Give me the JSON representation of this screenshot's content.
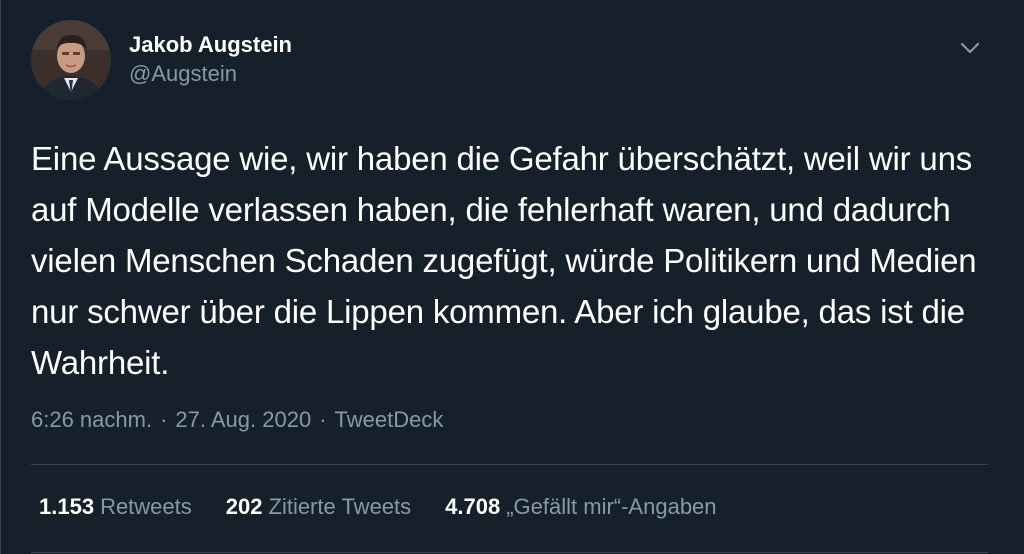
{
  "author": {
    "display_name": "Jakob Augstein",
    "handle": "@Augstein"
  },
  "tweet": {
    "text": "Eine Aussage wie, wir haben die Gefahr überschätzt, weil wir uns auf Modelle verlassen haben, die fehlerhaft waren, und dadurch vielen Menschen Schaden zugefügt, würde Politikern und Medien nur schwer über die Lippen kommen. Aber ich glaube, das ist die Wahrheit.",
    "time": "6:26 nachm.",
    "date": "27. Aug. 2020",
    "source": "TweetDeck",
    "separator": "·"
  },
  "stats": {
    "retweets_count": "1.153",
    "retweets_label": "Retweets",
    "quotes_count": "202",
    "quotes_label": "Zitierte Tweets",
    "likes_count": "4.708",
    "likes_label": "„Gefällt mir“-Angaben"
  },
  "icons": {
    "menu": "chevron-down-icon"
  },
  "colors": {
    "background": "#15202b",
    "text": "#ffffff",
    "secondary": "#8899a6",
    "divider": "#38444d"
  }
}
